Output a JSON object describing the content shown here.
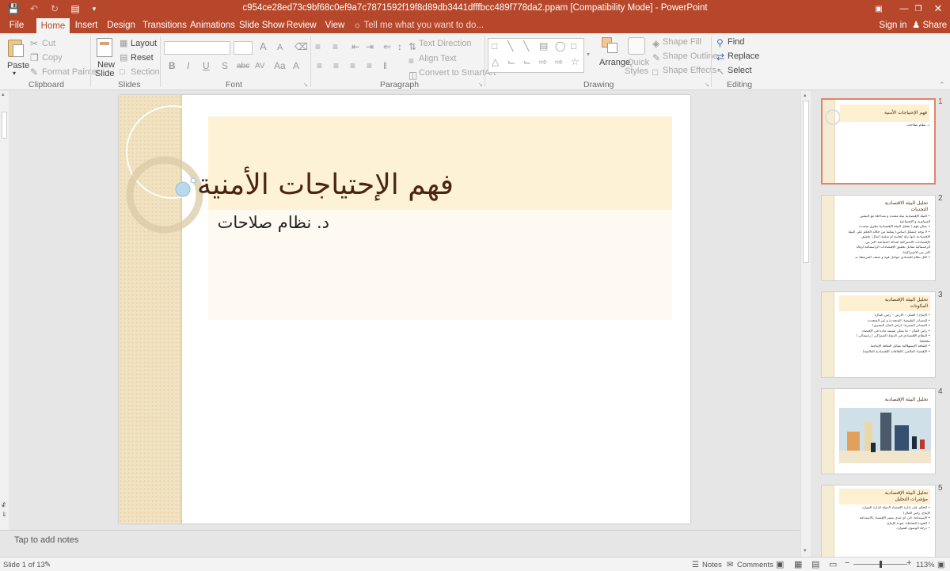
{
  "title": "c954ce28ed73c9bf68c0ef9a7c7871592f19f8d89db3441dfffbcc489f778da2.ppam [Compatibility Mode] - PowerPoint",
  "tabs": [
    "File",
    "Home",
    "Insert",
    "Design",
    "Transitions",
    "Animations",
    "Slide Show",
    "Review",
    "View"
  ],
  "tell_me": "Tell me what you want to do...",
  "sign_in": "Sign in",
  "share": "Share",
  "clipboard": {
    "paste": "Paste",
    "cut": "Cut",
    "copy": "Copy",
    "format_painter": "Format Painter",
    "label": "Clipboard"
  },
  "slides_group": {
    "new_slide_1": "New",
    "new_slide_2": "Slide",
    "layout": "Layout",
    "reset": "Reset",
    "section": "Section",
    "label": "Slides"
  },
  "font_group": {
    "label": "Font"
  },
  "paragraph_group": {
    "text_direction": "Text Direction",
    "align_text": "Align Text",
    "convert": "Convert to SmartArt",
    "label": "Paragraph"
  },
  "drawing_group": {
    "arrange": "Arrange",
    "quick_1": "Quick",
    "quick_2": "Styles",
    "shape_fill": "Shape Fill",
    "shape_outline": "Shape Outline",
    "shape_effects": "Shape Effects",
    "label": "Drawing"
  },
  "editing_group": {
    "find": "Find",
    "replace": "Replace",
    "select": "Select",
    "label": "Editing"
  },
  "slide": {
    "title": "فهم الإحتياجات الأمنية",
    "subtitle": "د. نظام صلاحات"
  },
  "notes_placeholder": "Tap to add notes",
  "thumbnails": [
    {
      "num": "1",
      "title": "فهم الإحتياجات الأمنية",
      "lines": [
        "د. نظام صلاحات"
      ]
    },
    {
      "num": "2",
      "title": "تحليل البيئة الاقتصادية",
      "title2": "التحديات",
      "lines": [
        "• البيئة الإقتصادية بيئة معقدة و متداخلة مع البيئتين",
        "السياسية و الإجتماعية",
        "• يمكن فهم / تحليل البيئة الإقتصادية بطرق متعددة",
        "• لا يوجد (بشكل أساس) يمكننا من خلاله الحكم على البيئة",
        "الإقتصادية بأنها بيئة ايجابية أو سلبية (مثال: تحقيق",
        "الإقتصادات الاشتراكية لعدالة اجتماعية أكثر من",
        "الرأسمالية مقابل تحقيق الإقتصادات الرأسمالية لرفاه",
        "أكثر من الاشتراكية)",
        "• لكل نظام اقتصادي عوامل قوة و ضعف المرتبطة به"
      ]
    },
    {
      "num": "3",
      "title": "تحليل البيئة الإقتصادية",
      "title2": "المكونات",
      "lines": [
        "• الإنتاج ( العمل – الأرض – رأس المال)",
        "• المصادر الطبيعية: المتجددة و غير المتجددة",
        "• المصادر البشرية: (رأس المال البشري)",
        "• رأس المال – ما يمكن تقييمه ماديا في الإقتصاد",
        "• النظام الإقتصادي في الدولة (اشتراكي / رأسمالي /",
        "مختلط)",
        "• الثقافة الإستهلاكية مقابل الثقافة الإنتاجية",
        "• الإقتصاد العالمي (العلاقات الإقتصادية العالمية)"
      ]
    },
    {
      "num": "4",
      "title": "تحليل البيئة الإقتصادية",
      "lines": []
    },
    {
      "num": "5",
      "title": "تحليل البيئة الإقتصادية",
      "title2": "مؤشرات التحليل",
      "lines": [
        "• الحكم على إدارة الإقتصاد الدولة (إدارة الموارد،",
        "الإنتاج، رأس المال)",
        "• الإستدامة: الى أي مدى يتميز الإقتصاد بالاستدامة",
        "• الجودة الشاملة: جودة الإنتاج،",
        "• درجة الوصول للموارد."
      ]
    }
  ],
  "status": {
    "slide_of": "Slide 1 of 13",
    "notes": "Notes",
    "comments": "Comments",
    "zoom": "113%"
  },
  "colors": {
    "accent": "#b7472a",
    "title_text": "#4b2512",
    "band": "#f1e3c1"
  }
}
